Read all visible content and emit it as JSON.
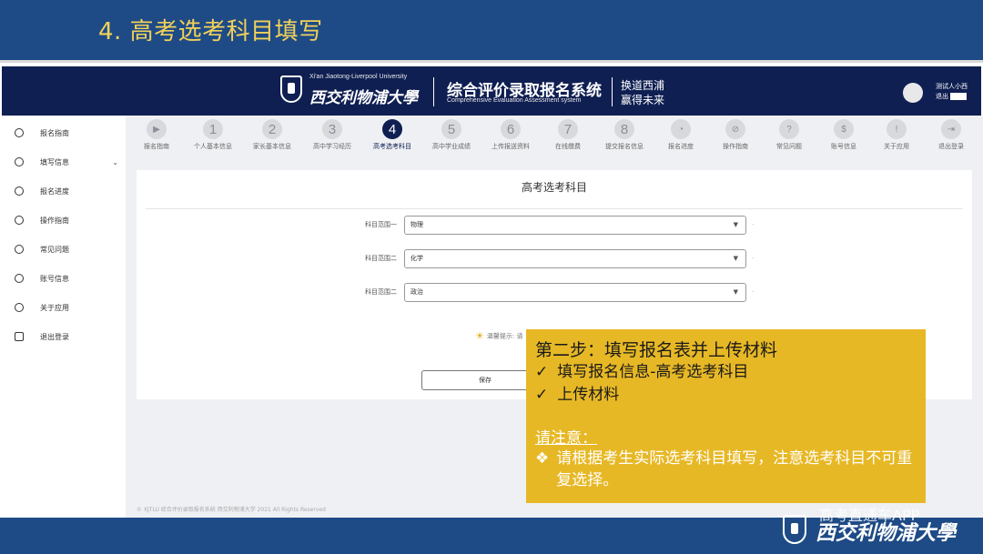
{
  "slide": {
    "title": "4. 高考选考科目填写"
  },
  "header": {
    "university_en": "Xi'an Jiaotong-Liverpool University",
    "university_cn": "西交利物浦大學",
    "system_cn": "综合评价录取报名系统",
    "system_en": "Comprehensive Evaluation Assessment system",
    "slogan_line1": "换道西浦",
    "slogan_line2": "赢得未来",
    "user_name": "测试人小西",
    "user_tag": "退出"
  },
  "sidebar": {
    "items": [
      {
        "label": "报名指南",
        "icon": "play-circle-icon"
      },
      {
        "label": "填写信息",
        "icon": "edit-icon",
        "chevron": "⌄"
      },
      {
        "label": "报名进度",
        "icon": "gauge-icon"
      },
      {
        "label": "操作指南",
        "icon": "compass-icon"
      },
      {
        "label": "常见问题",
        "icon": "question-icon"
      },
      {
        "label": "账号信息",
        "icon": "account-icon"
      },
      {
        "label": "关于应用",
        "icon": "info-icon"
      },
      {
        "label": "退出登录",
        "icon": "logout-icon"
      }
    ]
  },
  "steps": [
    {
      "mark": "▶",
      "label": "报名指南"
    },
    {
      "mark": "1",
      "label": "个人基本信息"
    },
    {
      "mark": "2",
      "label": "家长基本信息"
    },
    {
      "mark": "3",
      "label": "高中学习经历"
    },
    {
      "mark": "4",
      "label": "高考选考科目"
    },
    {
      "mark": "5",
      "label": "高中学业成绩"
    },
    {
      "mark": "6",
      "label": "上传报送资料"
    },
    {
      "mark": "7",
      "label": "在线缴费"
    },
    {
      "mark": "8",
      "label": "提交报名信息"
    },
    {
      "mark": "◔",
      "label": "报名进度"
    },
    {
      "mark": "⊘",
      "label": "操作指南"
    },
    {
      "mark": "?",
      "label": "常见问题"
    },
    {
      "mark": "$",
      "label": "账号信息"
    },
    {
      "mark": "!",
      "label": "关于应用"
    },
    {
      "mark": "⇥",
      "label": "退出登录"
    }
  ],
  "form": {
    "title": "高考选考科目",
    "fields": [
      {
        "label": "科目范围一",
        "value": "物理"
      },
      {
        "label": "科目范围二",
        "value": "化学"
      },
      {
        "label": "科目范围二",
        "value": "政治"
      }
    ],
    "hint": "温馨提示: 请",
    "save_label": "保存",
    "footer": "© XJTLU 综合评价录取报名系统 西交利物浦大学 2021 All Rights Reserved"
  },
  "note": {
    "title": "第二步：填写报名表并上传材料",
    "checks": [
      "填写报名信息-高考选考科目",
      "上传材料"
    ],
    "warning_title": "请注意：",
    "warning_body": "请根据考生实际选考科目填写，注意选考科目不可重复选择。"
  },
  "watermark": "高考直通车APP",
  "brand": "西交利物浦大學",
  "colors": {
    "slide_bg": "#1e4b86",
    "title": "#f2d15a",
    "header_bg": "#0f1f52",
    "note_bg": "#e7b825"
  }
}
